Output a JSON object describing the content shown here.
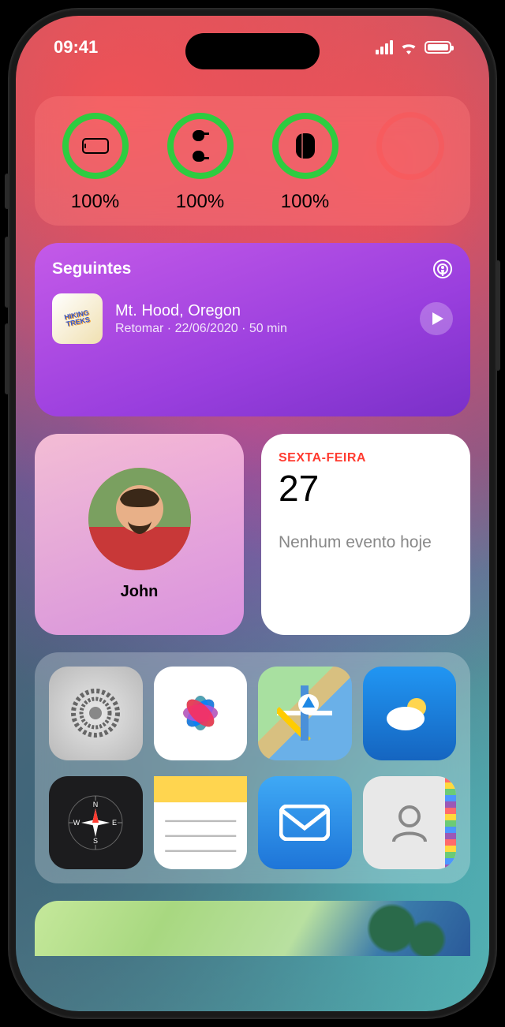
{
  "status": {
    "time": "09:41"
  },
  "batteries": {
    "items": [
      {
        "percent": "100%",
        "icon": "phone"
      },
      {
        "percent": "100%",
        "icon": "airpods"
      },
      {
        "percent": "100%",
        "icon": "case"
      }
    ]
  },
  "podcasts": {
    "header": "Seguintes",
    "artwork_text": "HIKING TREKS",
    "title": "Mt. Hood, Oregon",
    "subtitle": "Retomar · 22/06/2020 · 50 min"
  },
  "contact": {
    "name": "John"
  },
  "calendar": {
    "day_label": "SEXTA-FEIRA",
    "date": "27",
    "message": "Nenhum evento hoje"
  },
  "suggestions": {
    "apps": [
      {
        "name": "settings"
      },
      {
        "name": "photos"
      },
      {
        "name": "maps"
      },
      {
        "name": "weather"
      },
      {
        "name": "compass"
      },
      {
        "name": "notes"
      },
      {
        "name": "mail"
      },
      {
        "name": "contacts"
      }
    ]
  }
}
